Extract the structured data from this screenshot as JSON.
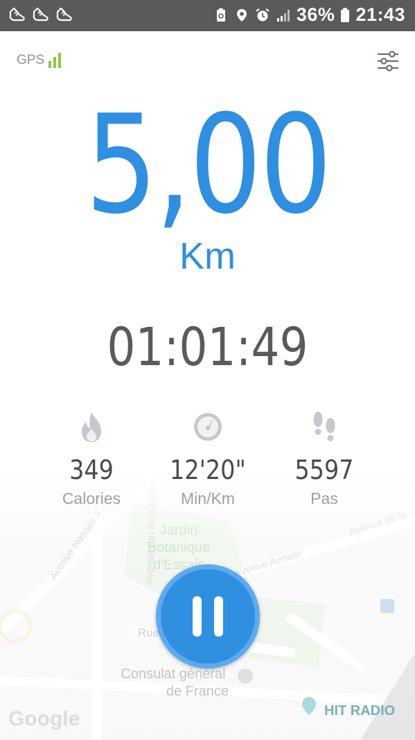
{
  "status_bar": {
    "notifications": [
      "shoe-icon",
      "shoe-icon",
      "shoe-icon"
    ],
    "status_icons": [
      "recycle-battery-icon",
      "location-icon",
      "alarm-icon",
      "signal-icon"
    ],
    "battery": "36%",
    "time": "21:43"
  },
  "header": {
    "gps_label": "GPS",
    "gps_signal_level": 3,
    "settings_icon": "sliders-icon"
  },
  "workout": {
    "distance": "5,00",
    "unit": "Km",
    "duration": "01:01:49"
  },
  "stats": [
    {
      "icon": "flame-icon",
      "value": "349",
      "label": "Calories"
    },
    {
      "icon": "speedometer-icon",
      "value": "12'20\"",
      "label": "Min/Km"
    },
    {
      "icon": "footprints-icon",
      "value": "5597",
      "label": "Pas"
    }
  ],
  "map": {
    "streets": [
      "Avenue Hassan II",
      "Avenue Ibn Al Ouazzani",
      "Avenue Annasr",
      "Avenue de la",
      "Rue"
    ],
    "places": [
      "Jardin",
      "Botanique",
      "d'Essais",
      "Consulat général",
      "de France",
      "HIT RADIO"
    ],
    "logo": "Google"
  },
  "controls": {
    "pause_icon": "pause-icon"
  },
  "colors": {
    "accent": "#2f8fe0",
    "status_bar": "#5a5a5a",
    "gps_signal": "#8fc73e",
    "text_dark": "#4a4a4a",
    "text_muted": "#9aa0a6"
  }
}
